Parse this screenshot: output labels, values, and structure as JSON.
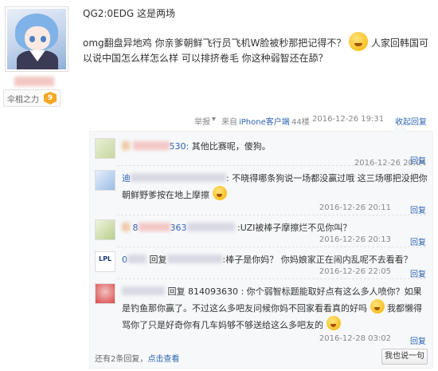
{
  "user": {
    "badge_name": "伞柤之力",
    "badge_level": "9"
  },
  "post": {
    "title": "QG2:0EDG 这是两场",
    "body_1": "omg翻盘异地鸡 你亲爹朝鲜飞行员飞机W脸被秒那把记得不？",
    "body_2": "人家回韩国可以说中国怎么样怎么样 可以排挤卷毛 你这种弱智还在舔？"
  },
  "meta": {
    "report": "举报",
    "report_caret": "▾",
    "source_prefix": "来自",
    "source_link": "iPhone客户端",
    "floor": "44楼",
    "time": "2016-12-26 19:31",
    "collapse": "收起回复"
  },
  "comments": [
    {
      "name_tail": "530:",
      "text": "其他比赛呢，傻狗。",
      "time": "2016-12-26 20:04",
      "reply": "回复"
    },
    {
      "name_head": "迪",
      "text": "不晓得哪条狗说一场都没赢过哦 这三场哪把没把你朝鲜野爹按在地上摩擦",
      "time": "2016-12-26 20:11",
      "reply": "回复"
    },
    {
      "name_head": "8",
      "name_mid": "363",
      "text": ":UZI被棒子摩擦烂不见你叫？",
      "time": "2016-12-26 20:13",
      "reply": "回复"
    },
    {
      "name_head": "0",
      "name_mid": "回复",
      "text": ":棒子是你妈？ 你妈娘家正在闹内乱呢不去看看？",
      "time": "2016-12-26 22:05",
      "reply": "回复"
    },
    {
      "text": "回复 814093630 : 你个弱智标题能取好点有这么多人喷你？如果是钓鱼那你赢了。不过这么多吧友问候你妈不回家看看真的好吗",
      "text_2": "我都懒得骂你了只是好奇你有几车妈够不够送给这么多吧友的",
      "time": "2016-12-28 03:02",
      "reply": "回复"
    }
  ],
  "footer": {
    "more_prefix": "还有2条回复，",
    "more_link": "点击查看",
    "say_button": "我也说一句"
  }
}
